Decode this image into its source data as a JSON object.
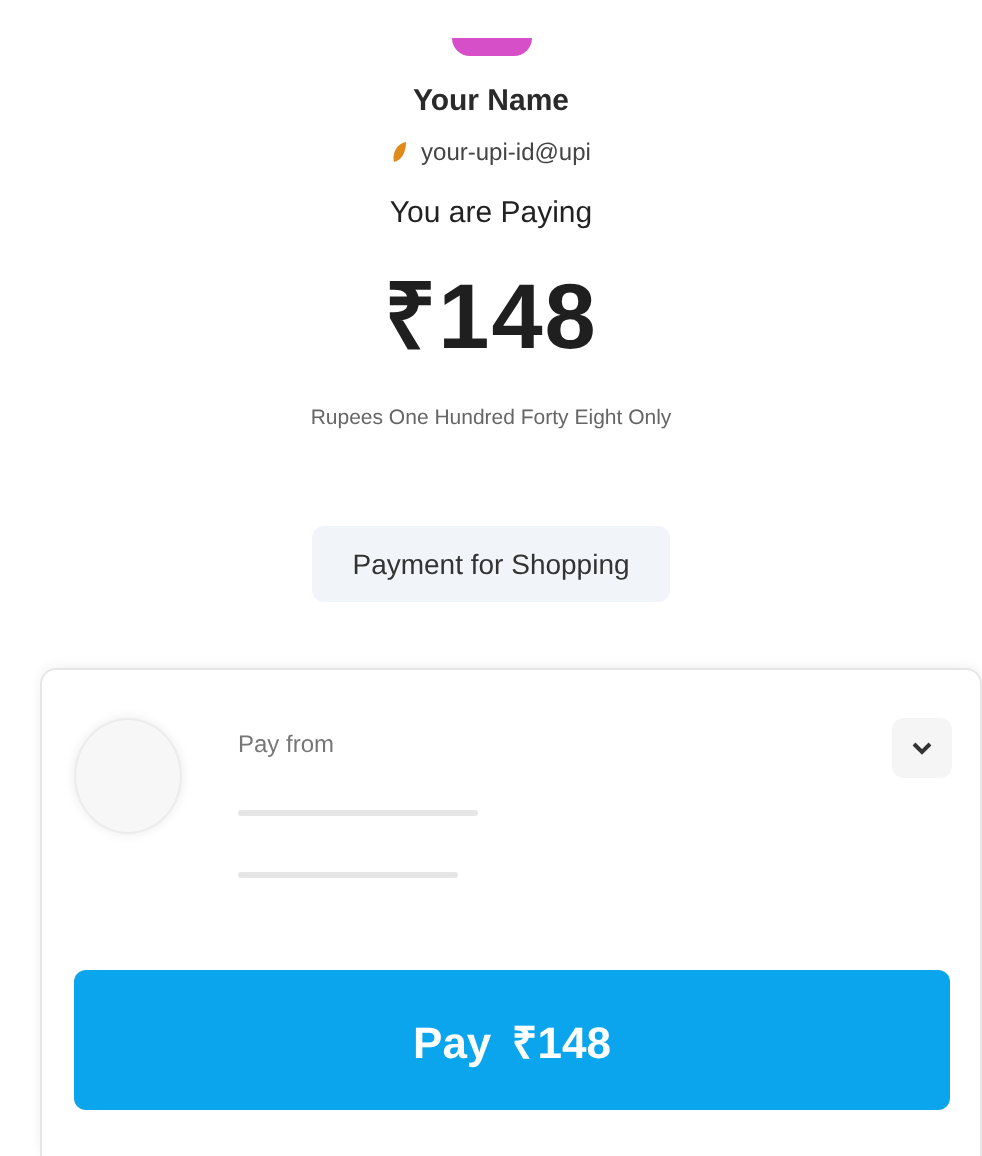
{
  "payee": {
    "name": "Your Name",
    "upi_id": "your-upi-id@upi"
  },
  "payment": {
    "heading": "You are Paying",
    "amount": "₹148",
    "amount_in_words": "Rupees One Hundred Forty Eight Only",
    "note": "Payment for Shopping"
  },
  "pay_from": {
    "label": "Pay from",
    "expanded": false
  },
  "pay_button": {
    "label": "Pay ₹148"
  }
}
